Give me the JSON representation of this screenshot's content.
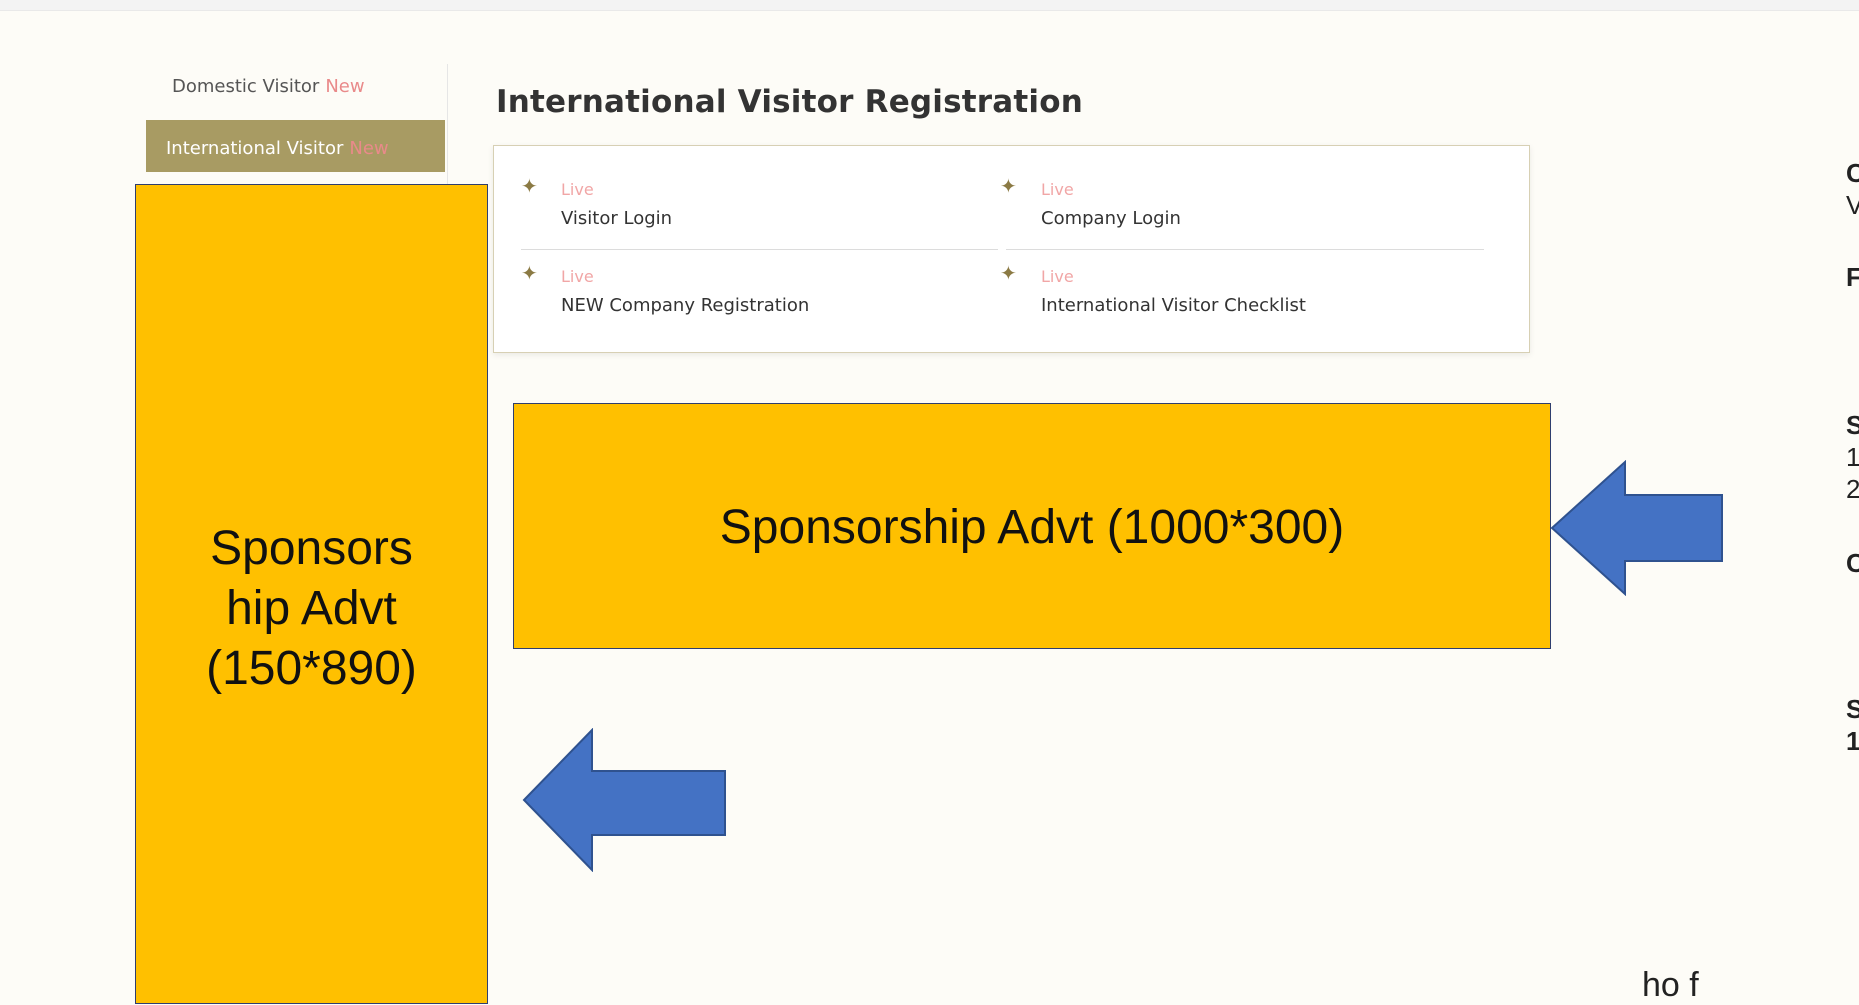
{
  "sidebar": {
    "items": [
      {
        "label": "Domestic Visitor",
        "badge": "New"
      },
      {
        "label": "International Visitor",
        "badge": "New"
      }
    ]
  },
  "ad_left": {
    "lines": [
      "Sponsors",
      "hip Advt",
      "(150*890)"
    ]
  },
  "page_title": "International Visitor Registration",
  "links": [
    {
      "status": "Live",
      "label": "Visitor Login"
    },
    {
      "status": "Live",
      "label": "Company Login"
    },
    {
      "status": "Live",
      "label": "NEW Company Registration"
    },
    {
      "status": "Live",
      "label": "International Visitor Checklist"
    }
  ],
  "ad_mid": {
    "label": "Sponsorship Advt (1000*300)"
  },
  "right_fragments": [
    "C",
    "V",
    "F",
    "S",
    "1",
    "2",
    "C",
    "S",
    "1"
  ],
  "bottom_fragment": "ho f",
  "colors": {
    "ad": "#ffc000",
    "arrow": "#4472c4",
    "menu_active": "#a89b63",
    "badge": "#e98a8a"
  }
}
